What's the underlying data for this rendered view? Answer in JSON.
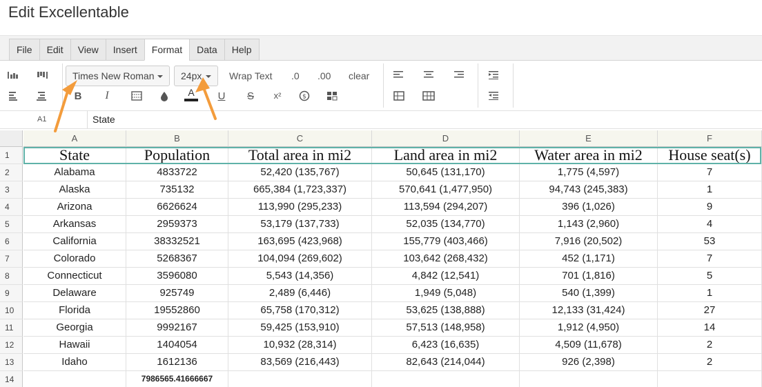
{
  "app": {
    "title": "Edit Excellentable"
  },
  "menu": {
    "tabs": [
      {
        "label": "File"
      },
      {
        "label": "Edit"
      },
      {
        "label": "View"
      },
      {
        "label": "Insert"
      },
      {
        "label": "Format"
      },
      {
        "label": "Data"
      },
      {
        "label": "Help"
      }
    ],
    "active_tab": "Format"
  },
  "toolbar": {
    "font_family": "Times New Roman",
    "font_size": "24px",
    "wrap_text": "Wrap Text",
    "decrease_decimal": ".0",
    "increase_decimal": ".00",
    "clear": "clear",
    "bold": "B",
    "italic": "I",
    "font_color": "A",
    "underline": "U",
    "strike": "S",
    "superscript": "x²"
  },
  "formula_bar": {
    "cell_ref": "A1",
    "value": "State"
  },
  "grid": {
    "columns": [
      "A",
      "B",
      "C",
      "D",
      "E",
      "F"
    ],
    "row_numbers": [
      "1",
      "2",
      "3",
      "4",
      "5",
      "6",
      "7",
      "8",
      "9",
      "10",
      "11",
      "12",
      "13",
      "14"
    ],
    "header": [
      "State",
      "Population",
      "Total area in mi2",
      "Land area in mi2",
      "Water area in mi2",
      "House seat(s)"
    ],
    "rows": [
      [
        "Alabama",
        "4833722",
        "52,420 (135,767)",
        "50,645 (131,170)",
        "1,775 (4,597)",
        "7"
      ],
      [
        "Alaska",
        "735132",
        "665,384 (1,723,337)",
        "570,641 (1,477,950)",
        "94,743 (245,383)",
        "1"
      ],
      [
        "Arizona",
        "6626624",
        "113,990 (295,233)",
        "113,594 (294,207)",
        "396 (1,026)",
        "9"
      ],
      [
        "Arkansas",
        "2959373",
        "53,179 (137,733)",
        "52,035 (134,770)",
        "1,143 (2,960)",
        "4"
      ],
      [
        "California",
        "38332521",
        "163,695 (423,968)",
        "155,779 (403,466)",
        "7,916 (20,502)",
        "53"
      ],
      [
        "Colorado",
        "5268367",
        "104,094 (269,602)",
        "103,642 (268,432)",
        "452 (1,171)",
        "7"
      ],
      [
        "Connecticut",
        "3596080",
        "5,543 (14,356)",
        "4,842 (12,541)",
        "701 (1,816)",
        "5"
      ],
      [
        "Delaware",
        "925749",
        "2,489 (6,446)",
        "1,949 (5,048)",
        "540 (1,399)",
        "1"
      ],
      [
        "Florida",
        "19552860",
        "65,758 (170,312)",
        "53,625 (138,888)",
        "12,133 (31,424)",
        "27"
      ],
      [
        "Georgia",
        "9992167",
        "59,425 (153,910)",
        "57,513 (148,958)",
        "1,912 (4,950)",
        "14"
      ],
      [
        "Hawaii",
        "1404054",
        "10,932 (28,314)",
        "6,423 (16,635)",
        "4,509 (11,678)",
        "2"
      ],
      [
        "Idaho",
        "1612136",
        "83,569 (216,443)",
        "82,643 (214,044)",
        "926 (2,398)",
        "2"
      ]
    ],
    "footer": [
      "",
      "7986565.41666667",
      "",
      "",
      "",
      ""
    ]
  },
  "colors": {
    "selection": "#5fb2a8",
    "arrow": "#f39c3c",
    "column_header_bg": "#f6f6ee"
  }
}
